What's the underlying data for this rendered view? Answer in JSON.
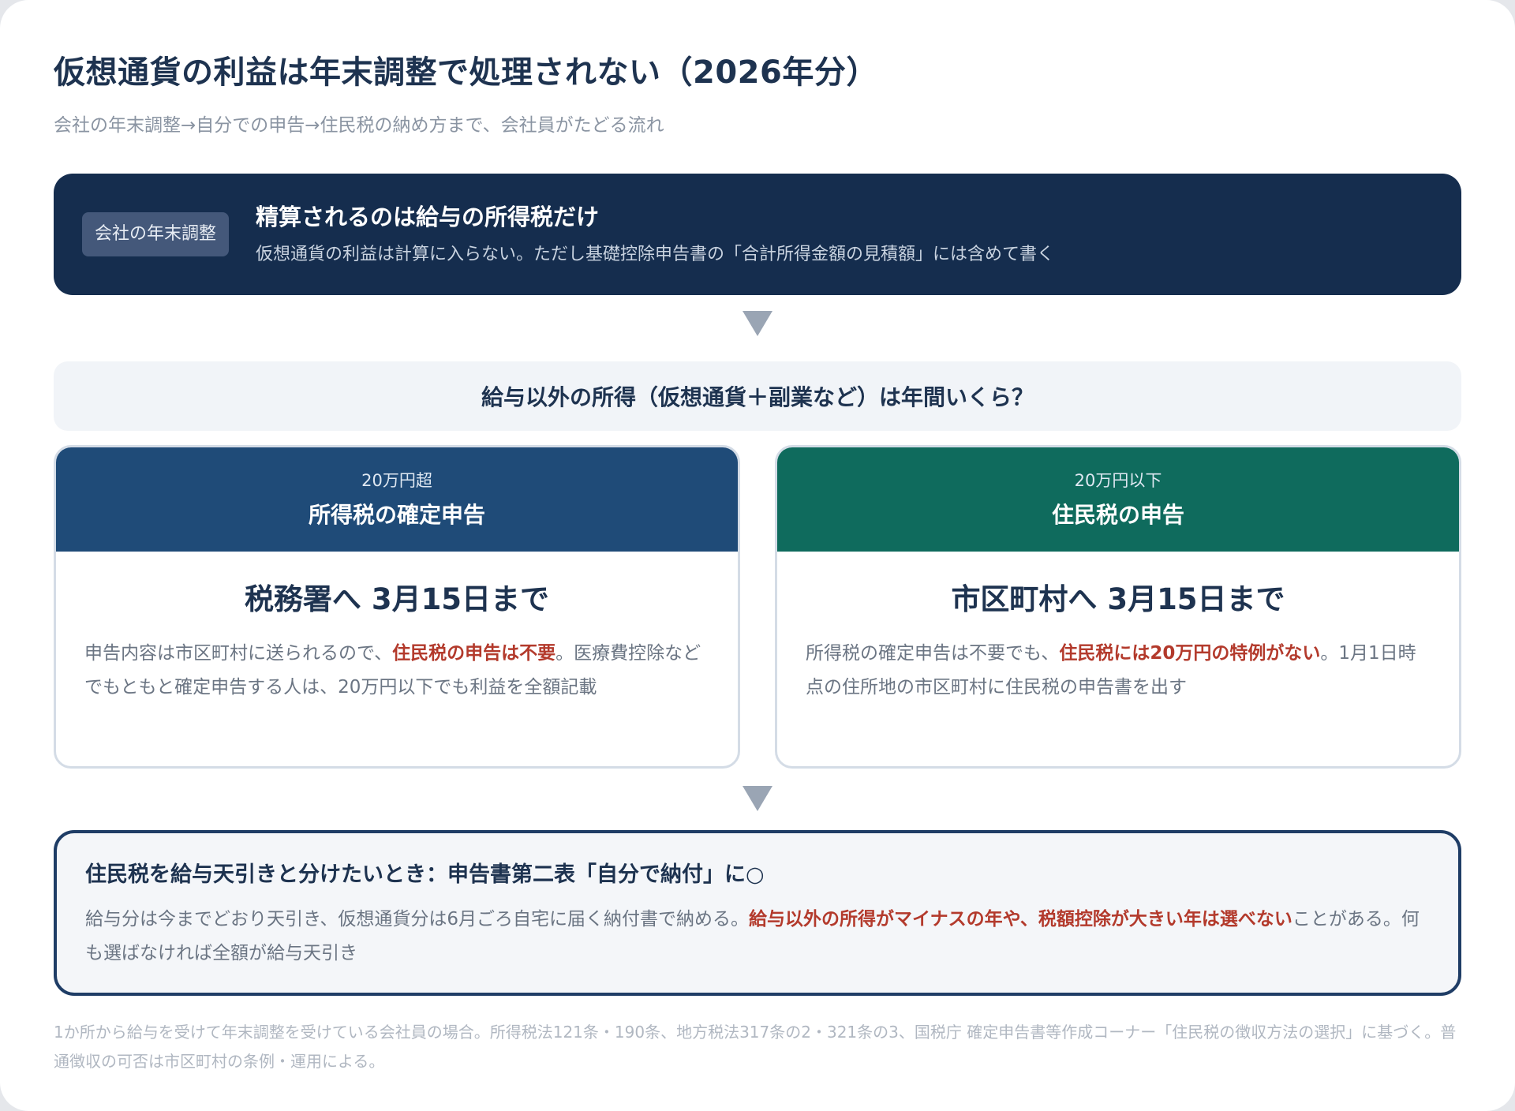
{
  "title": "仮想通貨の利益は年末調整で処理されない（2026年分）",
  "subtitle": "会社の年末調整→自分での申告→住民税の納め方まで、会社員がたどる流れ",
  "year_end": {
    "badge": "会社の年末調整",
    "heading": "精算されるのは給与の所得税だけ",
    "description": "仮想通貨の利益は計算に入らない。ただし基礎控除申告書の「合計所得金額の見積額」には含めて書く"
  },
  "question": "給与以外の所得（仮想通貨＋副業など）は年間いくら？",
  "cards": [
    {
      "condition": "20万円超",
      "title": "所得税の確定申告",
      "deadline": "税務署へ 3月15日まで",
      "desc_before": "申告内容は市区町村に送られるので、",
      "desc_highlight": "住民税の申告は不要",
      "desc_after": "。医療費控除などでもともと確定申告する人は、20万円以下でも利益を全額記載"
    },
    {
      "condition": "20万円以下",
      "title": "住民税の申告",
      "deadline": "市区町村へ 3月15日まで",
      "desc_before": "所得税の確定申告は不要でも、",
      "desc_highlight": "住民税には20万円の特例がない",
      "desc_after": "。1月1日時点の住所地の市区町村に住民税の申告書を出す"
    }
  ],
  "payment": {
    "heading": "住民税を給与天引きと分けたいとき：申告書第二表「自分で納付」に○",
    "desc_before": "給与分は今までどおり天引き、仮想通貨分は6月ごろ自宅に届く納付書で納める。",
    "desc_highlight": "給与以外の所得がマイナスの年や、税額控除が大きい年は選べない",
    "desc_after": "ことがある。何も選ばなければ全額が給与天引き"
  },
  "footnote": "1か所から給与を受けて年末調整を受けている会社員の場合。所得税法121条・190条、地方税法317条の2・321条の3、国税庁 確定申告書等作成コーナー「住民税の徴収方法の選択」に基づく。普通徴収の可否は市区町村の条例・運用による。",
  "colors": {
    "navy": "#152d4e",
    "blue_header": "#1f4b78",
    "green_header": "#0f6b5d",
    "highlight_red": "#b33a2c"
  }
}
